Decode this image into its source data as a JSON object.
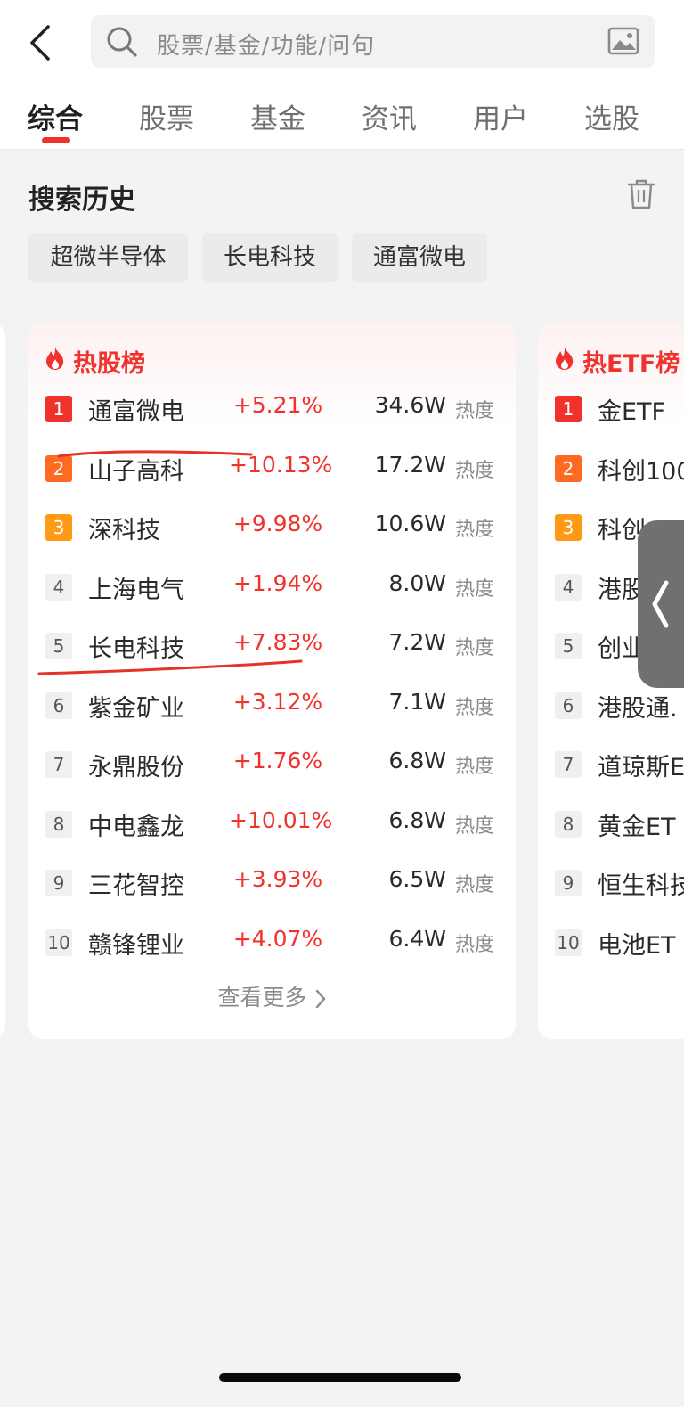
{
  "search": {
    "placeholder": "股票/基金/功能/问句"
  },
  "tabs": [
    {
      "label": "综合",
      "active": true
    },
    {
      "label": "股票",
      "active": false
    },
    {
      "label": "基金",
      "active": false
    },
    {
      "label": "资讯",
      "active": false
    },
    {
      "label": "用户",
      "active": false
    },
    {
      "label": "选股",
      "active": false
    }
  ],
  "history": {
    "title": "搜索历史",
    "chips": [
      "超微半导体",
      "长电科技",
      "通富微电"
    ]
  },
  "hot_stocks": {
    "title": "热股榜",
    "heat_label": "热度",
    "more_label": "查看更多",
    "rows": [
      {
        "rank": "1",
        "name": "通富微电",
        "change": "+5.21%",
        "heat": "34.6W"
      },
      {
        "rank": "2",
        "name": "山子高科",
        "change": "+10.13%",
        "heat": "17.2W"
      },
      {
        "rank": "3",
        "name": "深科技",
        "change": "+9.98%",
        "heat": "10.6W"
      },
      {
        "rank": "4",
        "name": "上海电气",
        "change": "+1.94%",
        "heat": "8.0W"
      },
      {
        "rank": "5",
        "name": "长电科技",
        "change": "+7.83%",
        "heat": "7.2W"
      },
      {
        "rank": "6",
        "name": "紫金矿业",
        "change": "+3.12%",
        "heat": "7.1W"
      },
      {
        "rank": "7",
        "name": "永鼎股份",
        "change": "+1.76%",
        "heat": "6.8W"
      },
      {
        "rank": "8",
        "name": "中电鑫龙",
        "change": "+10.01%",
        "heat": "6.8W"
      },
      {
        "rank": "9",
        "name": "三花智控",
        "change": "+3.93%",
        "heat": "6.5W"
      },
      {
        "rank": "10",
        "name": "赣锋锂业",
        "change": "+4.07%",
        "heat": "6.4W"
      }
    ]
  },
  "hot_etf": {
    "title": "热ETF榜",
    "rows": [
      {
        "rank": "1",
        "name": "金ETF"
      },
      {
        "rank": "2",
        "name": "科创100"
      },
      {
        "rank": "3",
        "name": "科创"
      },
      {
        "rank": "4",
        "name": "港股"
      },
      {
        "rank": "5",
        "name": "创业"
      },
      {
        "rank": "6",
        "name": "港股通."
      },
      {
        "rank": "7",
        "name": "道琼斯E"
      },
      {
        "rank": "8",
        "name": "黄金ET"
      },
      {
        "rank": "9",
        "name": "恒生科技"
      },
      {
        "rank": "10",
        "name": "电池ET"
      }
    ]
  },
  "colors": {
    "accent": "#f0322d",
    "rank2": "#ff6a22",
    "rank3": "#ff9a17"
  }
}
